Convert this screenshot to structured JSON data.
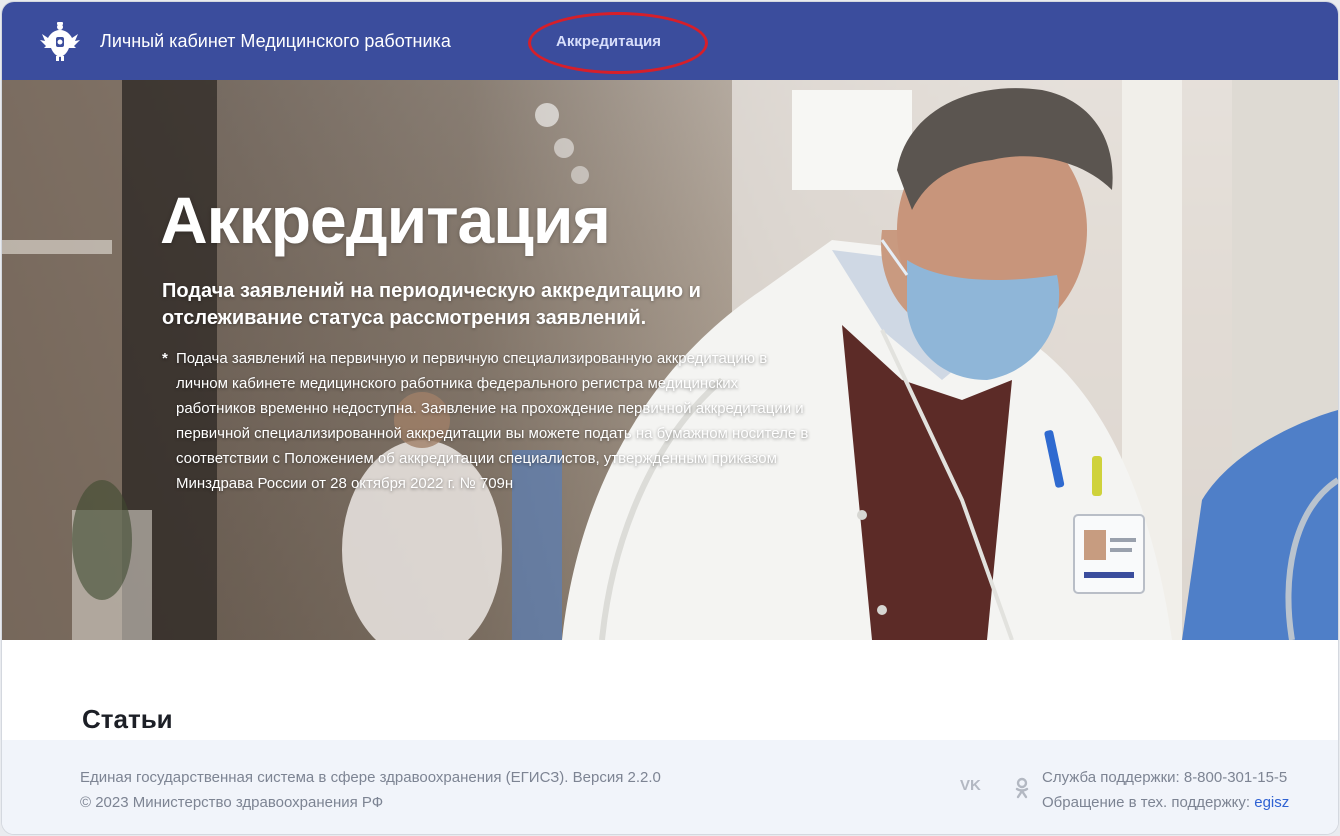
{
  "header": {
    "logo_icon": "double-headed-eagle-icon",
    "site_title": "Личный кабинет Медицинского работника",
    "nav_accreditation": "Аккредитация",
    "bg_color": "#3b4d9d"
  },
  "hero": {
    "title": "Аккредитация",
    "subtitle": "Подача заявлений на периодическую аккредитацию и отслеживание статуса рассмотрения заявлений.",
    "note_marker": "*",
    "note": "Подача заявлений на первичную и первичную специализированную аккредитацию в личном кабинете медицинского работника федерального регистра медицинских работников временно недоступна. Заявление на прохождение первичной аккредитации и первичной специализированной аккредитации вы можете подать на бумажном носителе в соответствии с Положением об аккредитации специалистов, утвержденным приказом Минздрава России от 28 октября 2022 г. № 709н"
  },
  "articles": {
    "title": "Статьи"
  },
  "footer": {
    "system_line": "Единая государственная система в сфере здравоохранения (ЕГИСЗ). Версия 2.2.0",
    "copyright": "© 2023 Министерство здравоохранения РФ",
    "vk_label": "VK",
    "support_phone": "Служба поддержки: 8-800-301-15-5",
    "support_request_label": "Обращение в тех. поддержку: ",
    "support_request_link": "egisz"
  },
  "colors": {
    "accent": "#3b4d9d",
    "highlight_ring": "#d61f2a",
    "link": "#2f62d3"
  }
}
